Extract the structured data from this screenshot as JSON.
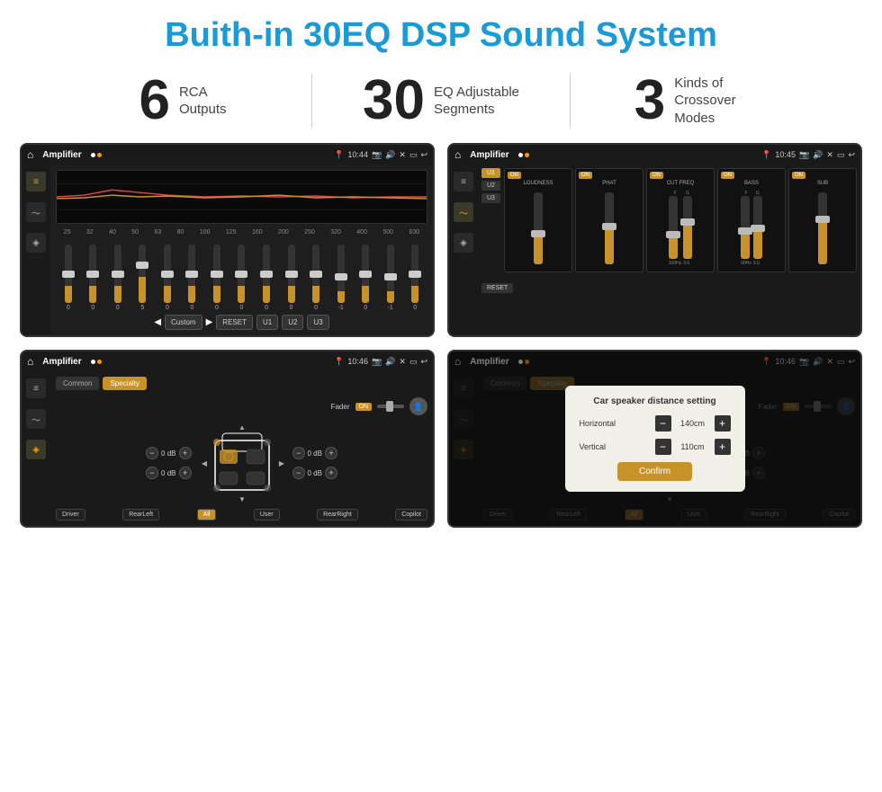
{
  "header": {
    "title": "Buith-in 30EQ DSP Sound System"
  },
  "stats": [
    {
      "number": "6",
      "text": "RCA\nOutputs"
    },
    {
      "number": "30",
      "text": "EQ Adjustable\nSegments"
    },
    {
      "number": "3",
      "text": "Kinds of\nCrossover Modes"
    }
  ],
  "screens": {
    "screen1": {
      "title": "Amplifier",
      "time": "10:44",
      "eq_frequencies": [
        "25",
        "32",
        "40",
        "50",
        "63",
        "80",
        "100",
        "125",
        "160",
        "200",
        "250",
        "320",
        "400",
        "500",
        "630"
      ],
      "eq_values": [
        "0",
        "0",
        "0",
        "5",
        "0",
        "0",
        "0",
        "0",
        "0",
        "0",
        "0",
        "-1",
        "0",
        "-1"
      ],
      "preset": "Custom",
      "buttons": [
        "RESET",
        "U1",
        "U2",
        "U3"
      ]
    },
    "screen2": {
      "title": "Amplifier",
      "time": "10:45",
      "presets": [
        "U1",
        "U2",
        "U3"
      ],
      "channels": [
        "LOUDNESS",
        "PHAT",
        "CUT FREQ",
        "BASS",
        "SUB"
      ]
    },
    "screen3": {
      "title": "Amplifier",
      "time": "10:46",
      "tabs": [
        "Common",
        "Specialty"
      ],
      "fader_label": "Fader",
      "speaker_positions": [
        "Driver",
        "RearLeft",
        "All",
        "User",
        "RearRight",
        "Copilot"
      ],
      "vol_values": [
        "0 dB",
        "0 dB",
        "0 dB",
        "0 dB"
      ]
    },
    "screen4": {
      "title": "Amplifier",
      "time": "10:46",
      "tabs": [
        "Common",
        "Specialty"
      ],
      "modal": {
        "title": "Car speaker distance setting",
        "horizontal_label": "Horizontal",
        "horizontal_value": "140cm",
        "vertical_label": "Vertical",
        "vertical_value": "110cm",
        "confirm_label": "Confirm"
      }
    }
  }
}
